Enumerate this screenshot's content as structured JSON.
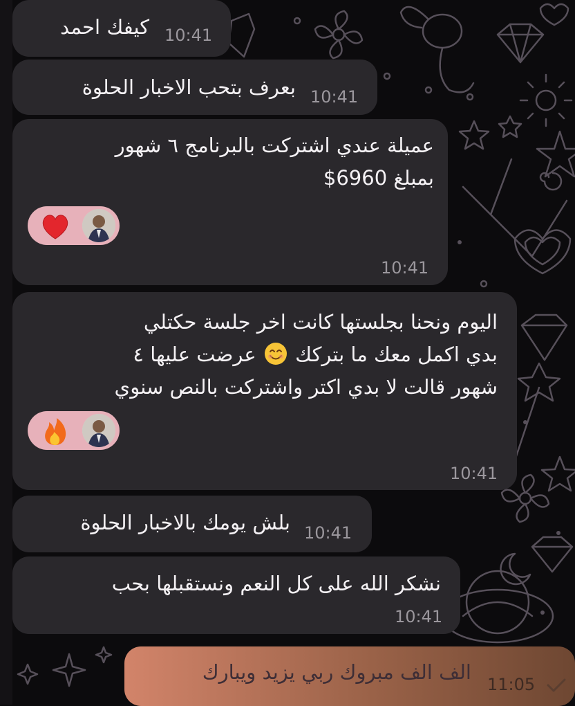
{
  "chat": {
    "messages": [
      {
        "lines": [
          "كيفك احمد"
        ],
        "time": "10:41"
      },
      {
        "lines": [
          "بعرف بتحب الاخبار الحلوة"
        ],
        "time": "10:41"
      },
      {
        "lines": [
          "عميلة عندي اشتركت بالبرنامج ٦ شهور",
          "بمبلغ 6960$"
        ],
        "time": "10:41",
        "reaction": "heart"
      },
      {
        "lines": [
          "اليوم ونحنا بجلستها كانت اخر جلسة حكتلي",
          "بدي اكمل معك ما بتركك",
          "عرضت عليها ٤",
          "شهور قالت لا بدي اكتر واشتركت  بالنص سنوي"
        ],
        "time": "10:41",
        "reaction": "fire"
      },
      {
        "lines": [
          "بلش يومك بالاخبار الحلوة"
        ],
        "time": "10:41"
      },
      {
        "lines": [
          "نشكر الله  على كل  النعم ونستقبلها بحب"
        ],
        "time": "10:41"
      }
    ],
    "outgoing": {
      "text": "الف الف مبروك ربي يزيد ويبارك",
      "time": "11:05",
      "status_icon": "check-icon"
    }
  },
  "colors": {
    "incoming_bubble": "#2a282c",
    "reaction_pill": "#e7b1ba",
    "outgoing_start": "#d2846a",
    "outgoing_end": "#6e4732"
  }
}
